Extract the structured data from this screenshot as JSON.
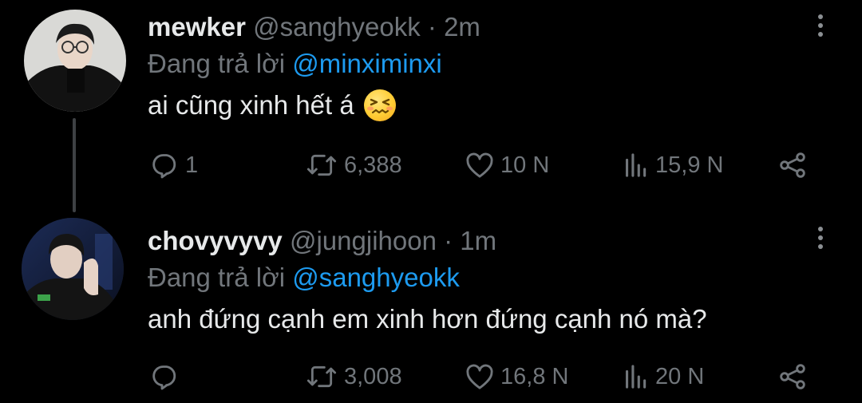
{
  "tweets": [
    {
      "display_name": "mewker",
      "handle": "@sanghyeokk",
      "separator": "·",
      "time": "2m",
      "reply_prefix": "Đang trả lời",
      "reply_to": "@minximinxi",
      "text": "ai cũng xinh hết á",
      "emoji": "confounded-face",
      "stats": {
        "replies": "1",
        "retweets": "6,388",
        "likes": "10 N",
        "views": "15,9 N"
      }
    },
    {
      "display_name": "chovyvyvy",
      "handle": "@jungjihoon",
      "separator": "·",
      "time": "1m",
      "reply_prefix": "Đang trả lời",
      "reply_to": "@sanghyeokk",
      "text": "anh đứng cạnh em xinh hơn đứng cạnh nó mà?",
      "stats": {
        "replies": "",
        "retweets": "3,008",
        "likes": "16,8 N",
        "views": "20 N"
      }
    }
  ],
  "icons": {
    "reply": "reply-icon",
    "retweet": "retweet-icon",
    "like": "heart-icon",
    "views": "views-icon",
    "share": "share-icon",
    "more": "more-vertical-icon"
  },
  "colors": {
    "background": "#000000",
    "text": "#e7e9ea",
    "muted": "#71767b",
    "mention": "#1d9bf0"
  }
}
